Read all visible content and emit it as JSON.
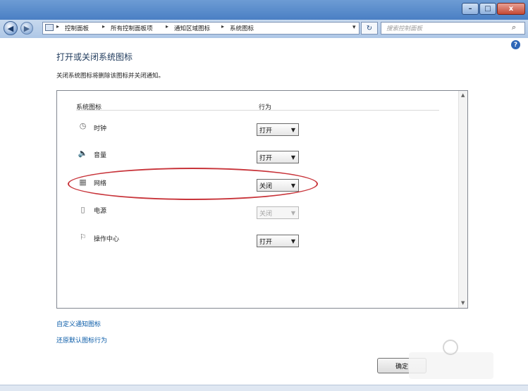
{
  "window": {
    "minimize_glyph": "–",
    "maximize_glyph": "□",
    "close_glyph": "x"
  },
  "address": {
    "back_glyph": "◀",
    "forward_glyph": "▶",
    "crumbs": [
      "控制面板",
      "所有控制面板项",
      "通知区域图标",
      "系统图标"
    ],
    "separator": "▸",
    "dropdown_glyph": "▾",
    "refresh_glyph": "↻",
    "search_placeholder": "搜索控制面板",
    "search_glyph": "⌕"
  },
  "help_glyph": "?",
  "page": {
    "title": "打开或关闭系统图标",
    "description": "关闭系统图标将删除该图标并关闭通知。"
  },
  "table": {
    "col_icon": "系统图标",
    "col_behavior": "行为",
    "rows": [
      {
        "icon": "clock-icon",
        "glyph": "◷",
        "label": "时钟",
        "value": "打开",
        "enabled": true
      },
      {
        "icon": "volume-icon",
        "glyph": "🔈",
        "label": "音量",
        "value": "打开",
        "enabled": true
      },
      {
        "icon": "network-icon",
        "glyph": "▦",
        "label": "网络",
        "value": "关闭",
        "enabled": true
      },
      {
        "icon": "power-icon",
        "glyph": "▯",
        "label": "电源",
        "value": "关闭",
        "enabled": false
      },
      {
        "icon": "action-center-icon",
        "glyph": "⚐",
        "label": "操作中心",
        "value": "打开",
        "enabled": true
      }
    ]
  },
  "links": {
    "customize": "自定义通知图标",
    "restore": "还原默认图标行为"
  },
  "buttons": {
    "ok": "确定"
  },
  "colors": {
    "highlight_ellipse": "#c8343a",
    "link": "#0b5ca8",
    "title": "#1e395b"
  }
}
